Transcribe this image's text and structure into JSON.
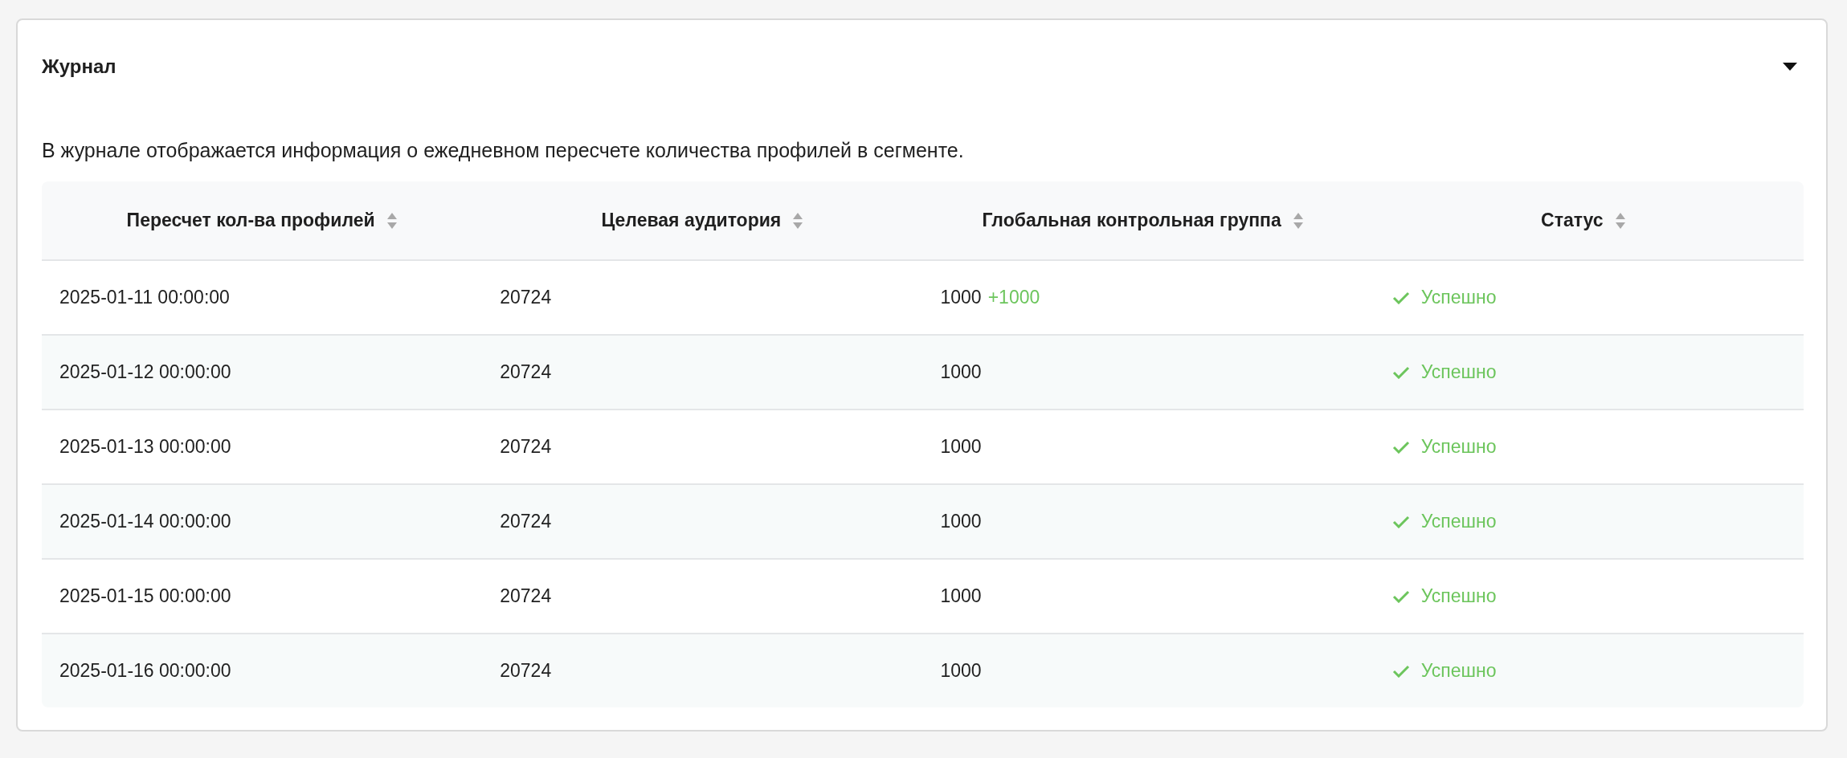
{
  "panel": {
    "title": "Журнал",
    "expanded": true,
    "description": "В журнале отображается информация о ежедневном пересчете количества профилей в сегменте."
  },
  "table": {
    "columns": [
      "Пересчет кол-ва профилей",
      "Целевая аудитория",
      "Глобальная контрольная группа",
      "Статус"
    ],
    "rows": [
      {
        "date": "2025-01-11 00:00:00",
        "audience": "20724",
        "control": "1000",
        "delta": "+1000",
        "status": "Успешно",
        "kind": "success"
      },
      {
        "date": "2025-01-12 00:00:00",
        "audience": "20724",
        "control": "1000",
        "status": "Успешно",
        "kind": "success"
      },
      {
        "date": "2025-01-13 00:00:00",
        "audience": "20724",
        "control": "1000",
        "status": "Успешно",
        "kind": "success"
      },
      {
        "date": "2025-01-14 00:00:00",
        "audience": "20724",
        "control": "1000",
        "status": "Успешно",
        "kind": "success"
      },
      {
        "date": "2025-01-15 00:00:00",
        "audience": "20724",
        "control": "1000",
        "status": "Успешно",
        "kind": "success"
      },
      {
        "date": "2025-01-16 00:00:00",
        "audience": "20724",
        "control": "1000",
        "status": "Успешно",
        "kind": "success"
      }
    ]
  }
}
